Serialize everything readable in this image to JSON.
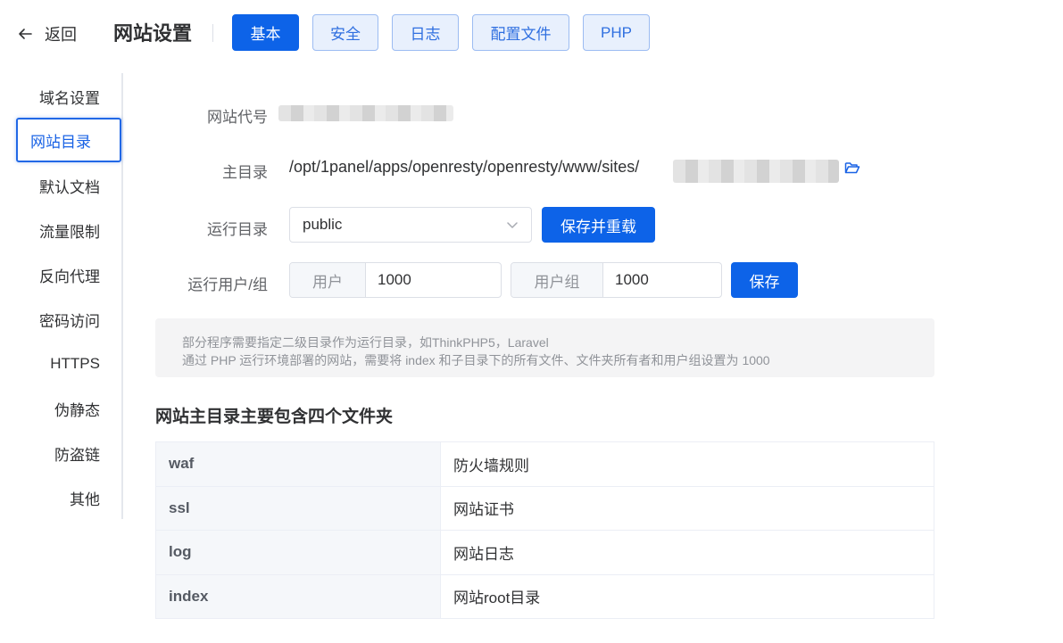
{
  "header": {
    "back_label": "返回",
    "page_title": "网站设置",
    "tabs": [
      {
        "label": "基本",
        "active": true
      },
      {
        "label": "安全",
        "active": false
      },
      {
        "label": "日志",
        "active": false
      },
      {
        "label": "配置文件",
        "active": false
      },
      {
        "label": "PHP",
        "active": false
      }
    ]
  },
  "sidebar": {
    "items": [
      {
        "label": "域名设置",
        "active": false
      },
      {
        "label": "网站目录",
        "active": true
      },
      {
        "label": "默认文档",
        "active": false
      },
      {
        "label": "流量限制",
        "active": false
      },
      {
        "label": "反向代理",
        "active": false
      },
      {
        "label": "密码访问",
        "active": false
      },
      {
        "label": "HTTPS",
        "active": false
      },
      {
        "label": "伪静态",
        "active": false
      },
      {
        "label": "防盗链",
        "active": false
      },
      {
        "label": "其他",
        "active": false
      }
    ]
  },
  "form": {
    "site_code_label": "网站代号",
    "main_dir_label": "主目录",
    "main_dir_path": "/opt/1panel/apps/openresty/openresty/www/sites/",
    "run_dir_label": "运行目录",
    "run_dir_value": "public",
    "save_reload_label": "保存并重载",
    "run_user_label": "运行用户/组",
    "user_prefix": "用户",
    "user_value": "1000",
    "group_prefix": "用户组",
    "group_value": "1000",
    "save_label": "保存"
  },
  "tip": {
    "line1": "部分程序需要指定二级目录作为运行目录，如ThinkPHP5，Laravel",
    "line2": "通过 PHP 运行环境部署的网站，需要将 index 和子目录下的所有文件、文件夹所有者和用户组设置为 1000"
  },
  "folders": {
    "title": "网站主目录主要包含四个文件夹",
    "rows": [
      {
        "name": "waf",
        "desc": "防火墙规则"
      },
      {
        "name": "ssl",
        "desc": "网站证书"
      },
      {
        "name": "log",
        "desc": "网站日志"
      },
      {
        "name": "index",
        "desc": "网站root目录"
      }
    ]
  },
  "colors": {
    "primary": "#0d63e8",
    "tab_inactive_bg": "#e8f0fd",
    "tip_bg": "#f4f4f5"
  },
  "icons": {
    "back": "arrow-left-icon",
    "folder": "folder-open-icon",
    "select": "chevron-down-icon"
  }
}
